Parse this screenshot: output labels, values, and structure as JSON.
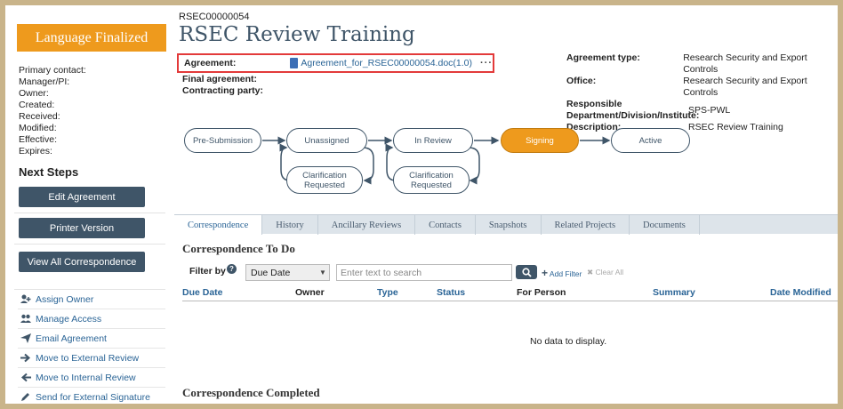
{
  "sidebar": {
    "status_banner": "Language Finalized",
    "meta": [
      "Primary contact:",
      "Manager/PI:",
      "Owner:",
      "Created:",
      "Received:",
      "Modified:",
      "Effective:",
      "Expires:"
    ],
    "next_steps_title": "Next Steps",
    "buttons": [
      "Edit Agreement",
      "Printer Version",
      "View All Correspondence"
    ],
    "actions": [
      {
        "icon": "assign-owner-icon",
        "label": "Assign Owner"
      },
      {
        "icon": "manage-access-icon",
        "label": "Manage Access"
      },
      {
        "icon": "send-email-icon",
        "label": "Email Agreement"
      },
      {
        "icon": "arrow-right-icon",
        "label": "Move to External Review"
      },
      {
        "icon": "arrow-left-icon",
        "label": "Move to Internal Review"
      },
      {
        "icon": "pencil-icon",
        "label": "Send for External Signature"
      }
    ]
  },
  "header": {
    "record_id": "RSEC00000054",
    "title": "RSEC Review Training",
    "agreement_label": "Agreement:",
    "agreement_doc": "Agreement_for_RSEC00000054.doc(1.0)",
    "more_glyph": "···",
    "final_agreement_label": "Final agreement:",
    "contracting_party_label": "Contracting party:"
  },
  "right_meta": [
    {
      "k": "Agreement type:",
      "v": "Research Security and Export Controls"
    },
    {
      "k": "Office:",
      "v": "Research Security and Export Controls"
    },
    {
      "k": "Responsible Department/Division/Institute:",
      "v": "SPS-PWL"
    },
    {
      "k": "Description:",
      "v": "RSEC Review Training"
    }
  ],
  "workflow": {
    "states": [
      "Pre-Submission",
      "Unassigned",
      "In Review",
      "Signing",
      "Active",
      "Clarification Requested",
      "Clarification Requested"
    ],
    "current": "Signing"
  },
  "tabs": [
    "Correspondence",
    "History",
    "Ancillary Reviews",
    "Contacts",
    "Snapshots",
    "Related Projects",
    "Documents"
  ],
  "selected_tab": "Correspondence",
  "correspondence": {
    "todo_title": "Correspondence To Do",
    "filter_label": "Filter by",
    "filter_value": "Due Date",
    "search_placeholder": "Enter text to search",
    "add_filter": "Add Filter",
    "clear_all": "Clear All",
    "columns": [
      "Due Date",
      "Owner",
      "Type",
      "Status",
      "For Person",
      "Summary",
      "Date Modified"
    ],
    "no_data": "No data to display.",
    "completed_title": "Correspondence Completed"
  },
  "colors": {
    "accent": "#ee9a1d",
    "primary": "#3f5568",
    "link": "#2a6496",
    "highlight_border": "#e33a3a"
  }
}
